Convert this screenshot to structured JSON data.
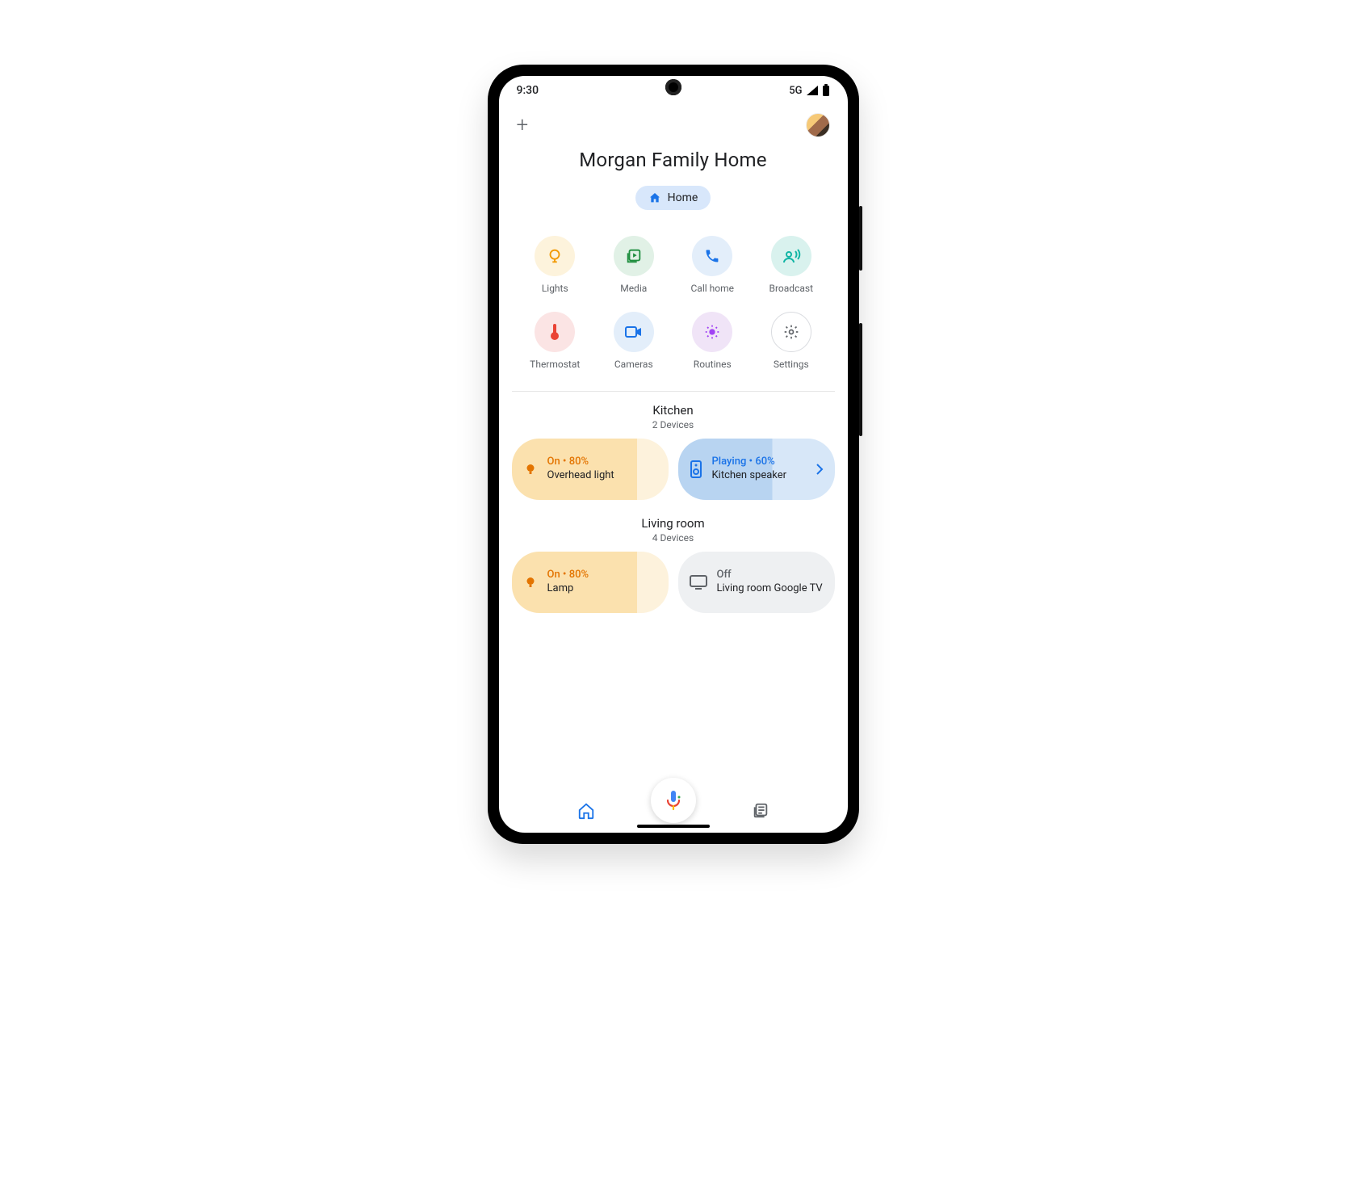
{
  "status": {
    "time": "9:30",
    "network": "5G"
  },
  "title": "Morgan Family Home",
  "chip": {
    "label": "Home"
  },
  "quick": [
    {
      "key": "lights",
      "label": "Lights"
    },
    {
      "key": "media",
      "label": "Media"
    },
    {
      "key": "call_home",
      "label": "Call home"
    },
    {
      "key": "broadcast",
      "label": "Broadcast"
    },
    {
      "key": "thermostat",
      "label": "Thermostat"
    },
    {
      "key": "cameras",
      "label": "Cameras"
    },
    {
      "key": "routines",
      "label": "Routines"
    },
    {
      "key": "settings",
      "label": "Settings"
    }
  ],
  "rooms": {
    "kitchen": {
      "name": "Kitchen",
      "sub": "2 Devices",
      "devices": [
        {
          "status": "On • 80%",
          "name": "Overhead light"
        },
        {
          "status": "Playing • 60%",
          "name": "Kitchen speaker"
        }
      ]
    },
    "living": {
      "name": "Living room",
      "sub": "4 Devices",
      "devices": [
        {
          "status": "On • 80%",
          "name": "Lamp"
        },
        {
          "status": "Off",
          "name": "Living room Google TV"
        }
      ]
    }
  }
}
